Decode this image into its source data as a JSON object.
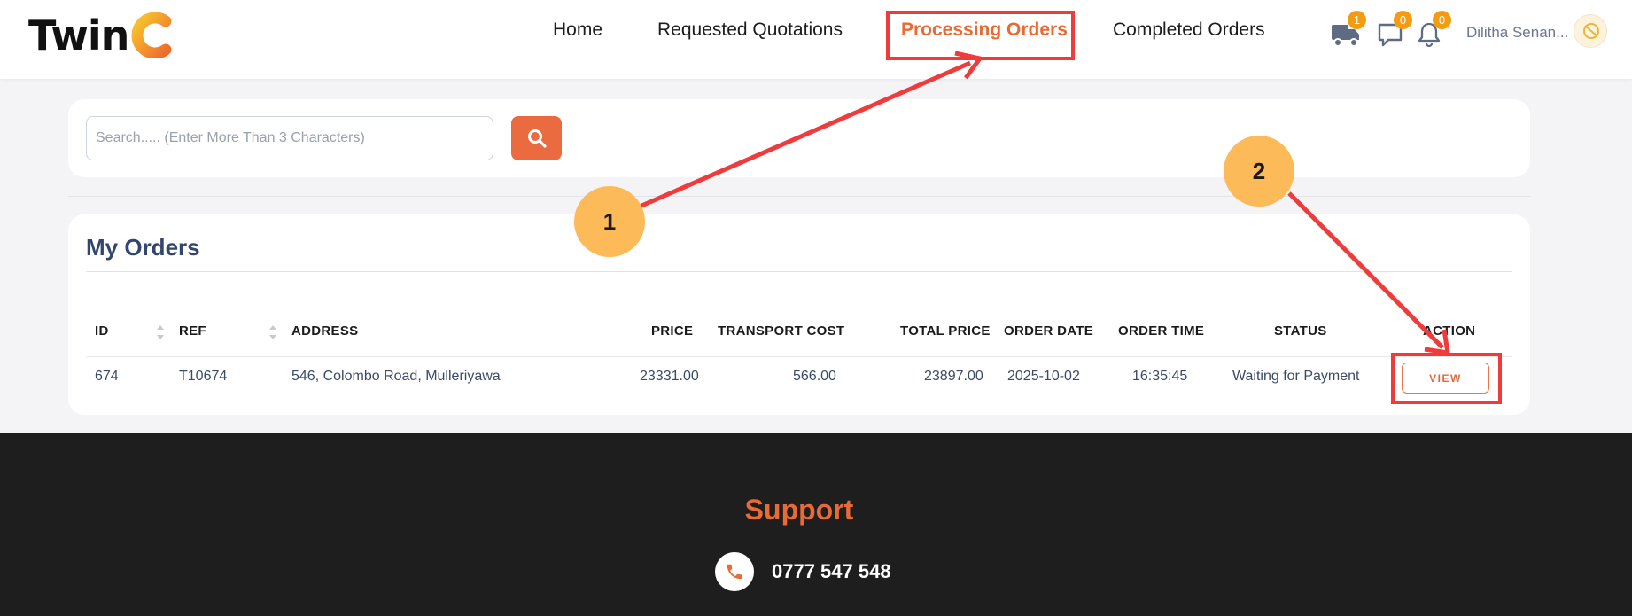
{
  "header": {
    "logo_text": "Twin",
    "nav": [
      "Home",
      "Requested Quotations",
      "Processing Orders",
      "Completed Orders"
    ],
    "active_nav": "Processing Orders",
    "icons": [
      {
        "name": "truck-icon",
        "badge": "1"
      },
      {
        "name": "chat-icon",
        "badge": "0"
      },
      {
        "name": "bell-icon",
        "badge": "0"
      }
    ],
    "user_name": "Dilitha Senan..."
  },
  "search": {
    "placeholder": "Search..... (Enter More Than 3 Characters)",
    "button_icon": "search-icon"
  },
  "orders": {
    "title": "My Orders",
    "columns": [
      "ID",
      "REF",
      "ADDRESS",
      "PRICE",
      "TRANSPORT COST",
      "TOTAL PRICE",
      "ORDER DATE",
      "ORDER TIME",
      "STATUS",
      "ACTION"
    ],
    "rows": [
      {
        "id": "674",
        "ref": "T10674",
        "address": "546, Colombo Road, Mulleriyawa",
        "price": "23331.00",
        "transport_cost": "566.00",
        "total_price": "23897.00",
        "order_date": "2025-10-02",
        "order_time": "16:35:45",
        "status": "Waiting for Payment",
        "action": "VIEW"
      }
    ]
  },
  "footer": {
    "support_title": "Support",
    "phone": "0777 547 548"
  },
  "annotations": {
    "step1": "1",
    "step2": "2",
    "color": "#ef3b3b"
  },
  "colors": {
    "accent": "#ea6a35",
    "badge": "#f39c12",
    "footer_bg": "#1e1e1e"
  }
}
